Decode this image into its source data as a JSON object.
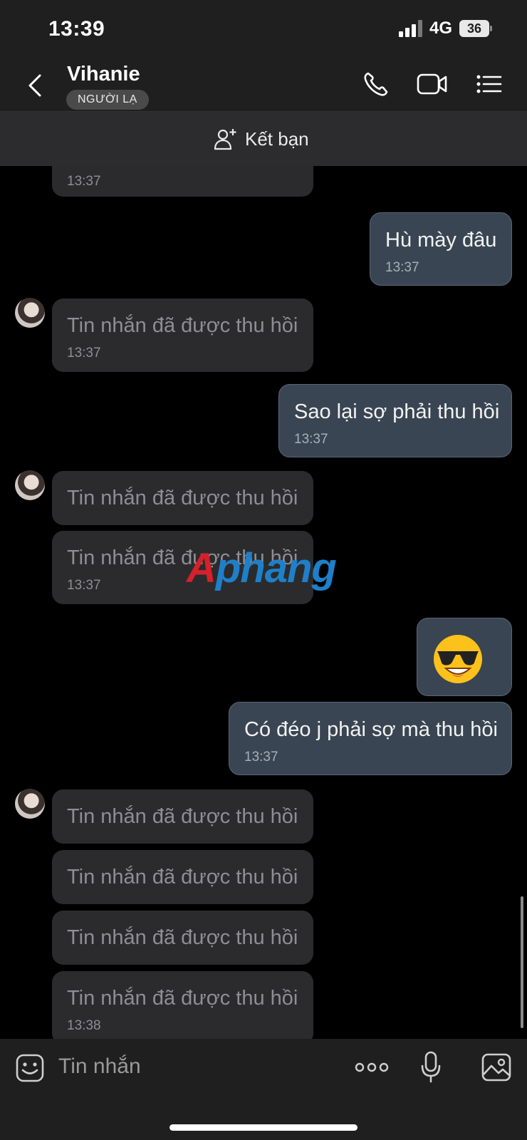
{
  "status": {
    "time": "13:39",
    "network": "4G",
    "battery": "36"
  },
  "header": {
    "contact_name": "Vihanie",
    "badge": "NGƯỜI LẠ",
    "icons": [
      "back-icon",
      "phone-icon",
      "video-icon",
      "menu-icon"
    ]
  },
  "add_friend": {
    "label": "Kết bạn"
  },
  "messages": [
    {
      "direction": "in",
      "text": "",
      "time": "13:37"
    },
    {
      "direction": "out",
      "text": "Hù mày đâu",
      "time": "13:37"
    },
    {
      "direction": "in",
      "text": "Tin nhắn đã được thu hồi",
      "time": "13:37"
    },
    {
      "direction": "out",
      "text": "Sao lại sợ phải thu hồi",
      "time": "13:37"
    },
    {
      "direction": "in",
      "text": "Tin nhắn đã được thu hồi",
      "time": ""
    },
    {
      "direction": "in",
      "text": "Tin nhắn đã được thu hồi",
      "time": "13:37"
    },
    {
      "direction": "out",
      "text": "😎",
      "time": ""
    },
    {
      "direction": "out",
      "text": "Có đéo j phải sợ mà thu hồi",
      "time": "13:37"
    },
    {
      "direction": "in",
      "text": "Tin nhắn đã được thu hồi",
      "time": ""
    },
    {
      "direction": "in",
      "text": "Tin nhắn đã được thu hồi",
      "time": ""
    },
    {
      "direction": "in",
      "text": "Tin nhắn đã được thu hồi",
      "time": ""
    },
    {
      "direction": "in",
      "text": "Tin nhắn đã được thu hồi",
      "time": "13:38"
    }
  ],
  "watermark": {
    "part1": "A",
    "part2": "phang"
  },
  "composer": {
    "placeholder": "Tin nhắn",
    "icons": [
      "sticker-icon",
      "more-icon",
      "microphone-icon",
      "image-icon"
    ]
  },
  "colors": {
    "background": "#000000",
    "bar": "#1f1f1f",
    "incoming_bubble": "#2b2b2d",
    "outgoing_bubble": "#3a4553"
  }
}
